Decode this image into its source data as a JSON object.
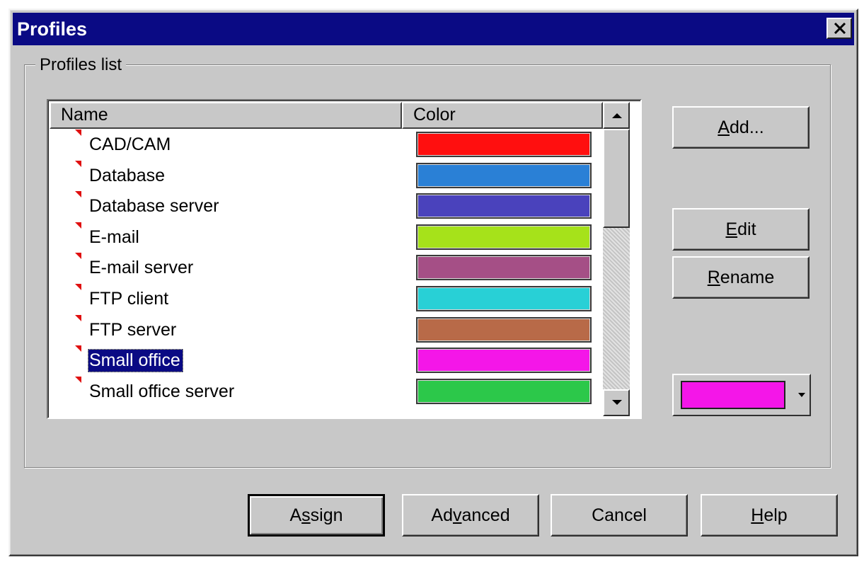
{
  "window": {
    "title": "Profiles"
  },
  "group": {
    "label": "Profiles list"
  },
  "list": {
    "columns": {
      "name": "Name",
      "color": "Color"
    },
    "rows": [
      {
        "name": "CAD/CAM",
        "color": "#ff0f0f"
      },
      {
        "name": "Database",
        "color": "#2a80d6"
      },
      {
        "name": "Database server",
        "color": "#4a42bc"
      },
      {
        "name": "E-mail",
        "color": "#a6e21a"
      },
      {
        "name": "E-mail server",
        "color": "#a54f86"
      },
      {
        "name": "FTP client",
        "color": "#28d0d6"
      },
      {
        "name": "FTP server",
        "color": "#b86a48"
      },
      {
        "name": "Small office",
        "color": "#f416e8",
        "selected": true
      },
      {
        "name": "Small office server",
        "color": "#2cc84a"
      }
    ]
  },
  "side_buttons": {
    "add": {
      "pre": "",
      "mn": "A",
      "post": "dd..."
    },
    "edit": {
      "pre": "",
      "mn": "E",
      "post": "dit"
    },
    "rename": {
      "pre": "",
      "mn": "R",
      "post": "ename"
    }
  },
  "color_picker": {
    "selected_color": "#f416e8"
  },
  "bottom_buttons": {
    "assign": {
      "pre": "A",
      "mn": "s",
      "post": "sign"
    },
    "advanced": {
      "pre": "Ad",
      "mn": "v",
      "post": "anced"
    },
    "cancel": {
      "pre": "Cancel",
      "mn": "",
      "post": ""
    },
    "help": {
      "pre": "",
      "mn": "H",
      "post": "elp"
    }
  },
  "icons": {
    "close": "close-icon",
    "scroll_up": "arrow-up-icon",
    "scroll_down": "arrow-down-icon",
    "dropdown": "chevron-down-icon"
  },
  "colors": {
    "titlebar": "#0a0a84",
    "face": "#c8c8c8",
    "profile_marker": "#e01010"
  }
}
